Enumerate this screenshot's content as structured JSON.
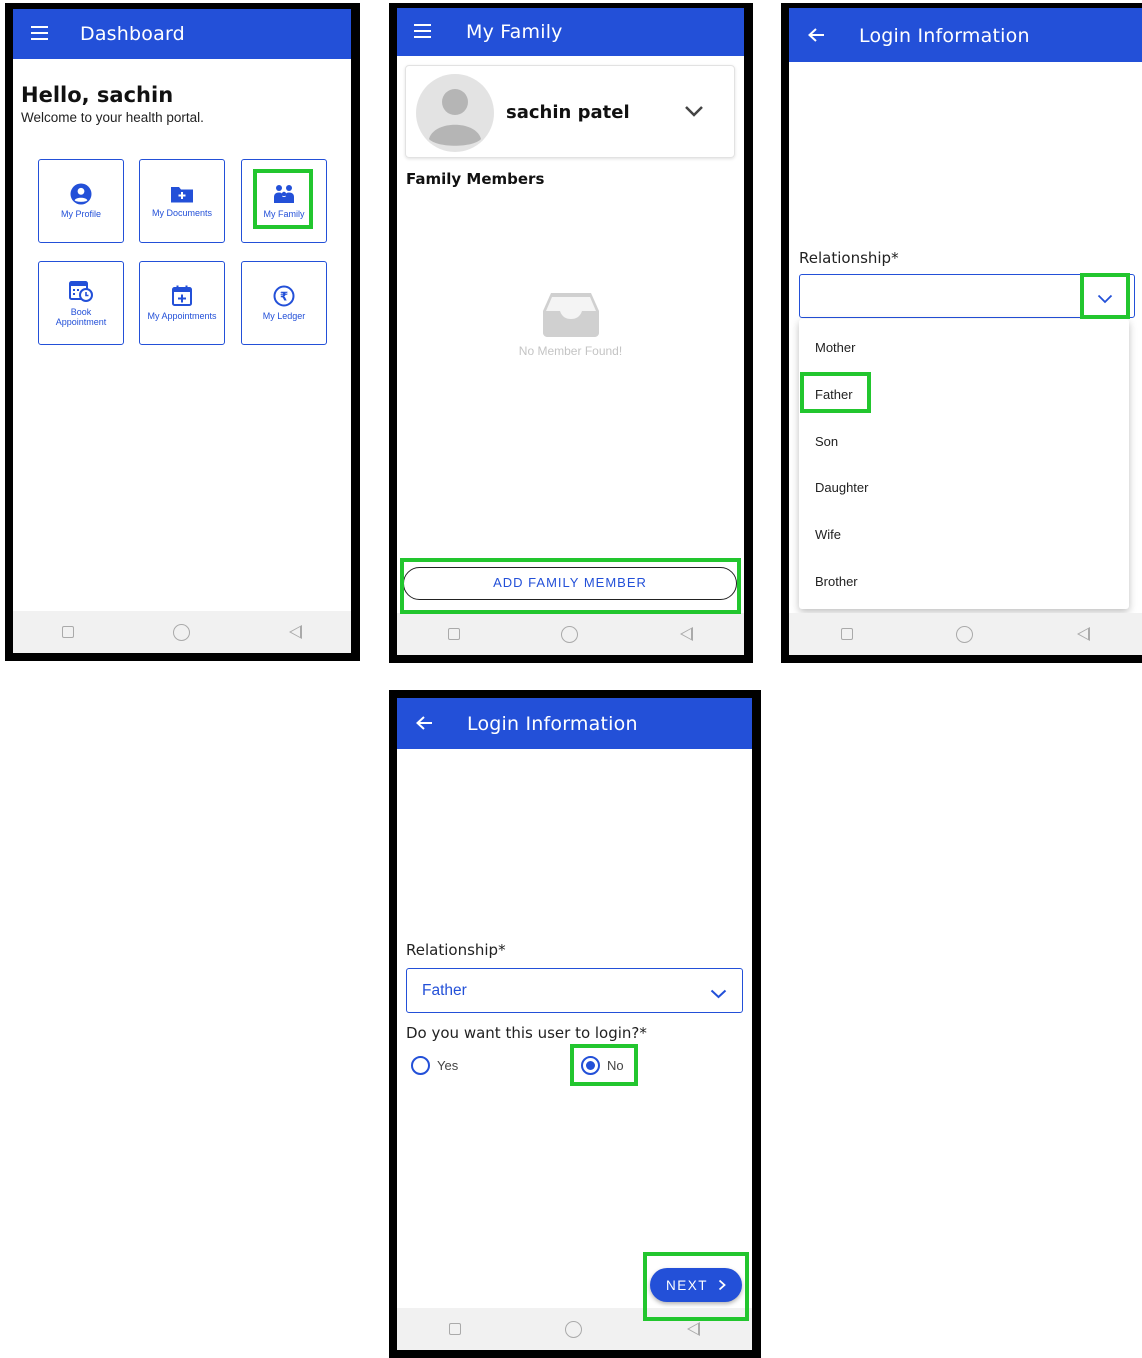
{
  "screen_dashboard": {
    "title": "Dashboard",
    "greeting": "Hello, sachin",
    "subtitle": "Welcome to your health portal.",
    "tiles": [
      {
        "label": "My Profile"
      },
      {
        "label": "My Documents"
      },
      {
        "label": "My Family"
      },
      {
        "label": "Book Appointment"
      },
      {
        "label": "My Appointments"
      },
      {
        "label": "My Ledger"
      }
    ]
  },
  "screen_family": {
    "title": "My Family",
    "profile_name": "sachin patel",
    "section_title": "Family Members",
    "empty_text": "No Member Found!",
    "add_button": "ADD FAMILY MEMBER"
  },
  "screen_login_dropdown": {
    "title": "Login Information",
    "field_label": "Relationship*",
    "options": [
      "Mother",
      "Father",
      "Son",
      "Daughter",
      "Wife",
      "Brother"
    ]
  },
  "screen_login_form": {
    "title": "Login Information",
    "field_label": "Relationship*",
    "selected_value": "Father",
    "question": "Do you want this user to login?*",
    "yes_label": "Yes",
    "no_label": "No",
    "next_button": "NEXT"
  },
  "colors": {
    "accent": "#2350d8",
    "highlight": "#22c62e"
  }
}
